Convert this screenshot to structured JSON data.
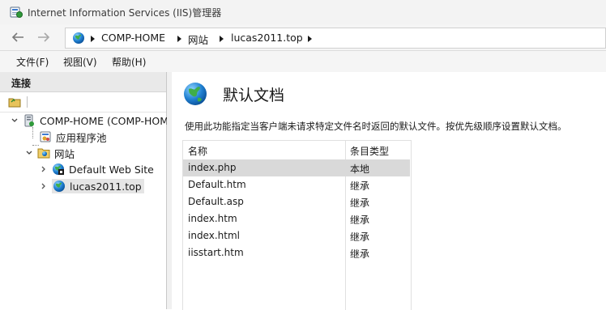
{
  "window": {
    "title": "Internet Information Services (IIS)管理器"
  },
  "breadcrumb": [
    "COMP-HOME",
    "网站",
    "lucas2011.top"
  ],
  "menu": [
    "文件(F)",
    "视图(V)",
    "帮助(H)"
  ],
  "connections": {
    "title": "连接",
    "tree": {
      "server": "COMP-HOME (COMP-HOM",
      "app_pools": "应用程序池",
      "sites": "网站",
      "site_default": "Default Web Site",
      "site_lucas": "lucas2011.top"
    }
  },
  "feature": {
    "title": "默认文档",
    "description": "使用此功能指定当客户端未请求特定文件名时返回的默认文件。按优先级顺序设置默认文档。",
    "columns": {
      "name": "名称",
      "type": "条目类型"
    },
    "rows": [
      {
        "name": "index.php",
        "type": "本地"
      },
      {
        "name": "Default.htm",
        "type": "继承"
      },
      {
        "name": "Default.asp",
        "type": "继承"
      },
      {
        "name": "index.htm",
        "type": "继承"
      },
      {
        "name": "index.html",
        "type": "继承"
      },
      {
        "name": "iisstart.htm",
        "type": "继承"
      }
    ]
  },
  "icons": {
    "app": "iis-manager-icon",
    "nav_back": "arrow-left-icon",
    "nav_forward": "arrow-right-icon",
    "site": "globe-icon",
    "server": "server-icon",
    "app_pool": "app-pool-icon",
    "sites_folder": "folder-icon",
    "default_site": "globe-stopped-icon"
  },
  "colors": {
    "selection": "#d9d9d9",
    "tree_selection": "#e5e5e5",
    "header_bg": "#e9e9e9",
    "chrome_bg": "#f5f5f5"
  }
}
